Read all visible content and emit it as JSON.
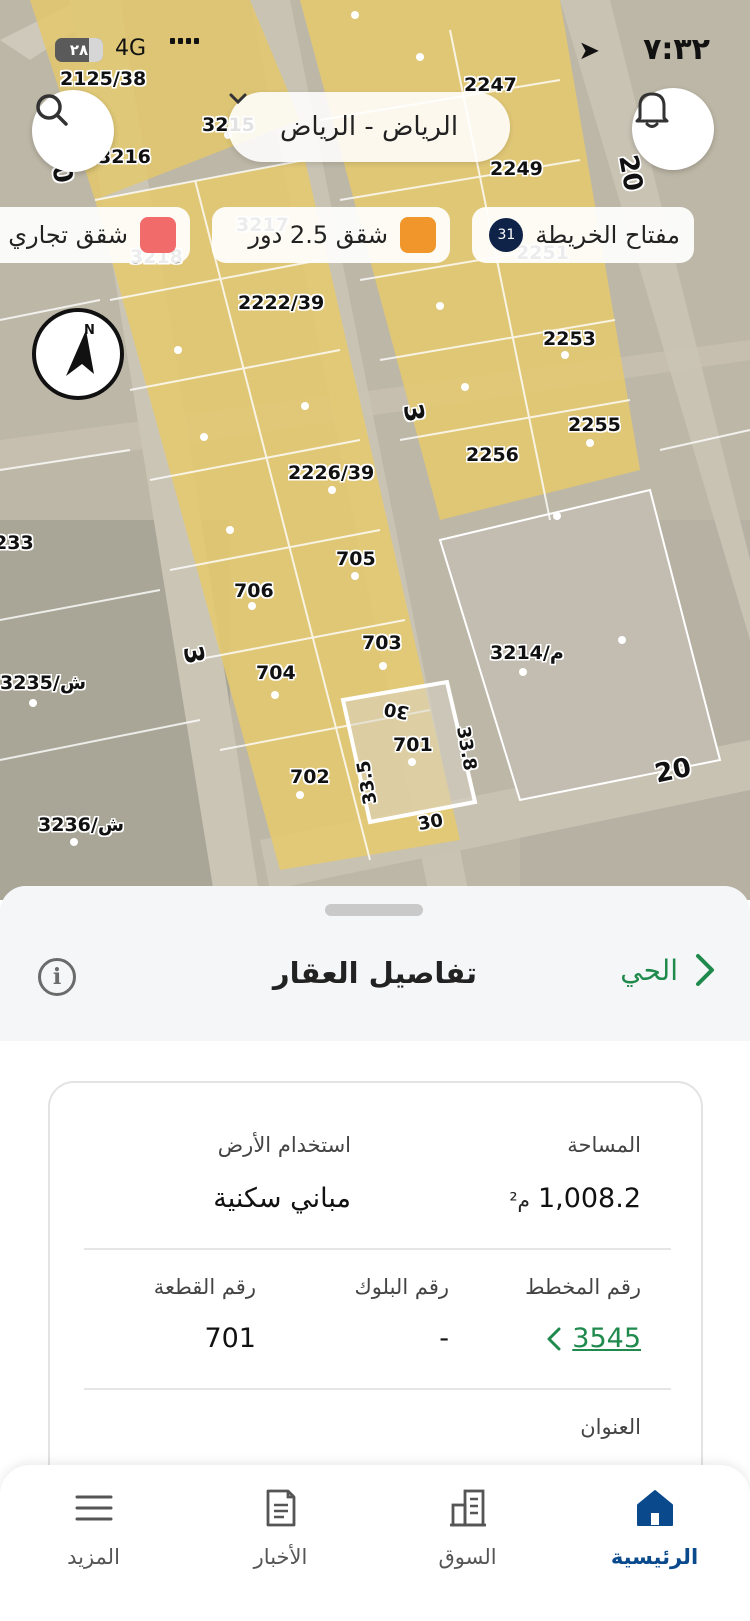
{
  "status_bar": {
    "time": "٧:٣٢",
    "battery": "٢٨",
    "network": "4G"
  },
  "top_bar": {
    "city": "الرياض - الرياض"
  },
  "filters": {
    "map_key": "مفتاح الخريطة",
    "map_key_count": "31",
    "residential": "شقق 2.5 دور",
    "residential_color": "#f0962a",
    "commercial": "شقق تجاري",
    "commercial_color": "#f26b6b"
  },
  "map": {
    "compass_letter": "N",
    "parcel_labels": [
      "2125/38",
      "3215",
      "3216",
      "2247",
      "2249",
      "3217",
      "3218",
      "2251",
      "2222/39",
      "2253",
      "2255",
      "2256",
      "2226/39",
      "233",
      "705",
      "706",
      "3214/م",
      "703",
      "3235/ش",
      "704",
      "701",
      "702",
      "3236/ش"
    ],
    "street_labels": [
      "20",
      "20",
      "3",
      "3",
      "20"
    ],
    "dimension_labels": [
      "30",
      "33.8",
      "33.5",
      "30"
    ]
  },
  "sheet": {
    "title": "تفاصيل العقار",
    "district_link": "الحي",
    "fields": {
      "area_label": "المساحة",
      "area_value": "1,008.2",
      "area_unit": "م²",
      "land_use_label": "استخدام الأرض",
      "land_use_value": "مباني سكنية",
      "plan_label": "رقم المخطط",
      "plan_value": "3545",
      "block_label": "رقم البلوك",
      "block_value": "-",
      "plot_label": "رقم القطعة",
      "plot_value": "701",
      "address_label": "العنوان"
    }
  },
  "bottom_nav": {
    "items": [
      {
        "label": "الرئيسية",
        "icon": "home-icon"
      },
      {
        "label": "السوق",
        "icon": "buildings-icon"
      },
      {
        "label": "الأخبار",
        "icon": "news-icon"
      },
      {
        "label": "المزيد",
        "icon": "menu-icon"
      }
    ]
  },
  "colors": {
    "accent_green": "#1f8a4c",
    "nav_active": "#0a4a8c",
    "parcel_yellow": "#e5c96f"
  }
}
